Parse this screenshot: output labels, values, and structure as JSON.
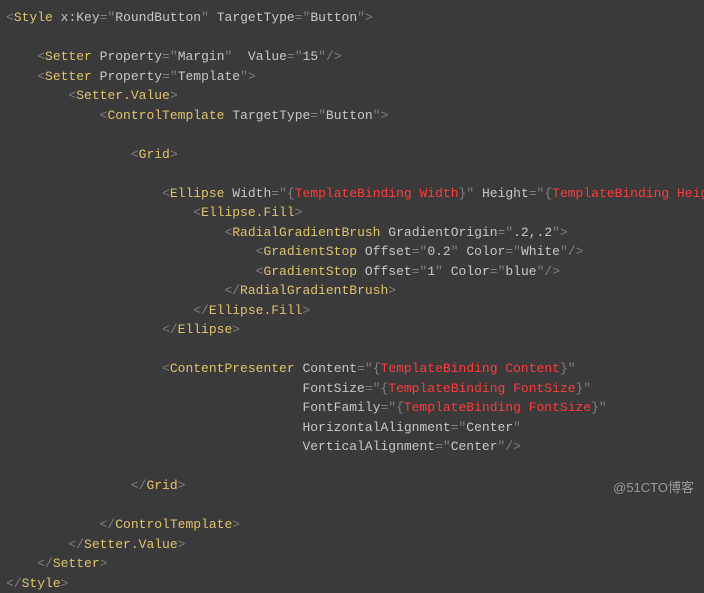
{
  "watermark": "@51CTO博客",
  "code": {
    "elem": {
      "Style": "Style",
      "Setter": "Setter",
      "SetterValue": "Setter.Value",
      "ControlTemplate": "ControlTemplate",
      "Grid": "Grid",
      "Ellipse": "Ellipse",
      "EllipseFill": "Ellipse.Fill",
      "RadialGradientBrush": "RadialGradientBrush",
      "GradientStop": "GradientStop",
      "ContentPresenter": "ContentPresenter"
    },
    "attr": {
      "xkey": "x:Key",
      "TargetType": "TargetType",
      "Property": "Property",
      "Value": "Value",
      "Width": "Width",
      "Height": "Height",
      "GradientOrigin": "GradientOrigin",
      "Offset": "Offset",
      "Color": "Color",
      "Content": "Content",
      "FontSize": "FontSize",
      "FontFamily": "FontFamily",
      "HorizontalAlignment": "HorizontalAlignment",
      "VerticalAlignment": "VerticalAlignment"
    },
    "val": {
      "RoundButton": "RoundButton",
      "Button": "Button",
      "Margin": "Margin",
      "Fifteen": "15",
      "Template": "Template",
      "GradientOrigin": ".2,.2",
      "Offset02": "0.2",
      "White": "White",
      "Offset1": "1",
      "Blue": "blue",
      "Center": "Center"
    },
    "bind": {
      "Width": "TemplateBinding Width",
      "Height": "TemplateBinding Height",
      "Content": "TemplateBinding Content",
      "FontSize": "TemplateBinding FontSize"
    }
  }
}
